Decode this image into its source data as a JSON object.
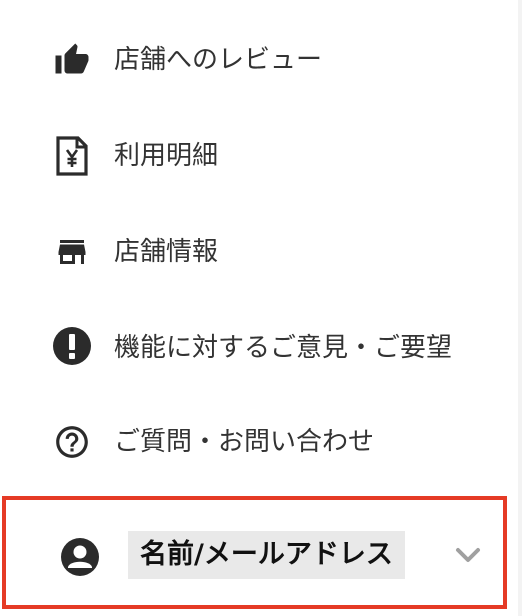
{
  "menu": {
    "items": [
      {
        "label": "店舗へのレビュー",
        "icon": "thumbs-up-icon"
      },
      {
        "label": "利用明細",
        "icon": "yen-receipt-icon"
      },
      {
        "label": "店舗情報",
        "icon": "store-icon"
      },
      {
        "label": "機能に対するご意見・ご要望",
        "icon": "exclamation-circle-icon"
      },
      {
        "label": "ご質問・お問い合わせ",
        "icon": "question-circle-icon"
      }
    ]
  },
  "account": {
    "name_label": "名前/メールアドレス",
    "icon": "account-circle-icon",
    "expand_icon": "chevron-down-icon"
  },
  "colors": {
    "highlight_border": "#e53a25",
    "icon": "#2b2b2b",
    "text": "#333333",
    "chevron": "#a0a0a0",
    "name_background": "#e9e9e9"
  }
}
